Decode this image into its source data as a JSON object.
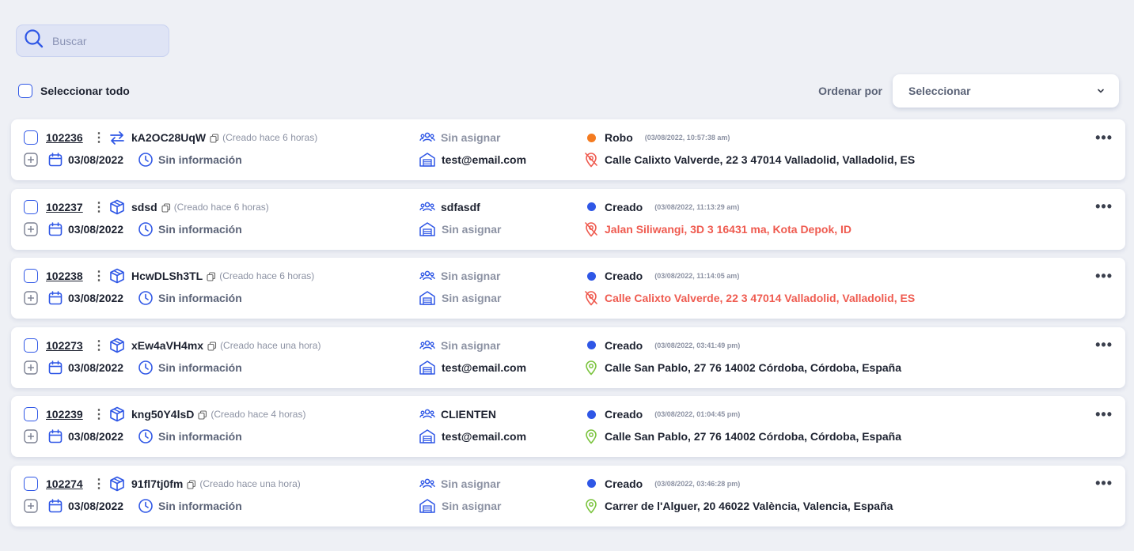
{
  "search": {
    "placeholder": "Buscar"
  },
  "select_all_label": "Seleccionar todo",
  "sort": {
    "label": "Ordenar por",
    "value": "Seleccionar"
  },
  "colors": {
    "accent": "#2f57e6",
    "orange": "#f47b20",
    "red": "#ef5b50",
    "green": "#7bc43e"
  },
  "rows": [
    {
      "id": "102236",
      "type_icon": "transfer-icon",
      "code": "kA2OC28UqW",
      "created": "(Creado hace 6 horas)",
      "date": "03/08/2022",
      "time_info": "Sin información",
      "assignee": "Sin asignar",
      "assignee_muted": true,
      "email": "test@email.com",
      "email_muted": false,
      "status": "Robo",
      "status_color": "#f47b20",
      "timestamp": "(03/08/2022, 10:57:38 am)",
      "address": "Calle Calixto Valverde, 22 3 47014 Valladolid, Valladolid, ES",
      "address_state": "invalid"
    },
    {
      "id": "102237",
      "type_icon": "box-icon",
      "code": "sdsd",
      "created": "(Creado hace 6 horas)",
      "date": "03/08/2022",
      "time_info": "Sin información",
      "assignee": "sdfasdf",
      "assignee_muted": false,
      "email": "Sin asignar",
      "email_muted": true,
      "status": "Creado",
      "status_color": "#2f57e6",
      "timestamp": "(03/08/2022, 11:13:29 am)",
      "address": "Jalan Siliwangi, 3D 3 16431 ma, Kota Depok, ID",
      "address_state": "error"
    },
    {
      "id": "102238",
      "type_icon": "box-icon",
      "code": "HcwDLSh3TL",
      "created": "(Creado hace 6 horas)",
      "date": "03/08/2022",
      "time_info": "Sin información",
      "assignee": "Sin asignar",
      "assignee_muted": true,
      "email": "Sin asignar",
      "email_muted": true,
      "status": "Creado",
      "status_color": "#2f57e6",
      "timestamp": "(03/08/2022, 11:14:05 am)",
      "address": "Calle Calixto Valverde, 22 3 47014 Valladolid, Valladolid, ES",
      "address_state": "error"
    },
    {
      "id": "102273",
      "type_icon": "box-icon",
      "code": "xEw4aVH4mx",
      "created": "(Creado hace una hora)",
      "date": "03/08/2022",
      "time_info": "Sin información",
      "assignee": "Sin asignar",
      "assignee_muted": true,
      "email": "test@email.com",
      "email_muted": false,
      "status": "Creado",
      "status_color": "#2f57e6",
      "timestamp": "(03/08/2022, 03:41:49 pm)",
      "address": "Calle San Pablo, 27 76 14002 Córdoba, Córdoba, España",
      "address_state": "valid"
    },
    {
      "id": "102239",
      "type_icon": "box-icon",
      "code": "kng50Y4lsD",
      "created": "(Creado hace 4 horas)",
      "date": "03/08/2022",
      "time_info": "Sin información",
      "assignee": "CLIENTEN",
      "assignee_muted": false,
      "email": "test@email.com",
      "email_muted": false,
      "status": "Creado",
      "status_color": "#2f57e6",
      "timestamp": "(03/08/2022, 01:04:45 pm)",
      "address": "Calle San Pablo, 27 76 14002 Córdoba, Córdoba, España",
      "address_state": "valid"
    },
    {
      "id": "102274",
      "type_icon": "box-icon",
      "code": "91fl7tj0fm",
      "created": "(Creado hace una hora)",
      "date": "03/08/2022",
      "time_info": "Sin información",
      "assignee": "Sin asignar",
      "assignee_muted": true,
      "email": "Sin asignar",
      "email_muted": true,
      "status": "Creado",
      "status_color": "#2f57e6",
      "timestamp": "(03/08/2022, 03:46:28 pm)",
      "address": "Carrer de l'Alguer, 20 46022 València, Valencia, España",
      "address_state": "valid"
    }
  ]
}
